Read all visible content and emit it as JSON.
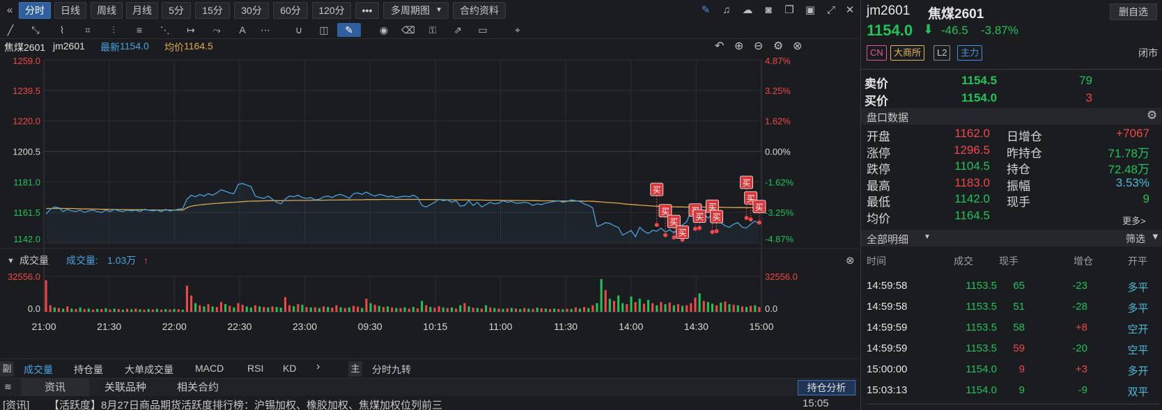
{
  "toolbar": {
    "periods": [
      "分时",
      "日线",
      "周线",
      "月线",
      "5分",
      "15分",
      "30分",
      "60分",
      "120分"
    ],
    "active_period": "分时",
    "more": "•••",
    "multi_period": "多周期图",
    "contract_info": "合约资料"
  },
  "header": {
    "name": "焦煤2601",
    "code": "jm2601",
    "latest_label": "最新",
    "latest_value": "1154.0",
    "avg_label": "均价",
    "avg_value": "1164.5"
  },
  "chart_data": {
    "type": "line",
    "price_axis": {
      "ticks": [
        "1259.0",
        "1239.5",
        "1220.0",
        "1200.5",
        "1181.0",
        "1161.5",
        "1142.0"
      ],
      "min": 1142.0,
      "max": 1259.0,
      "base": 1200.5
    },
    "pct_axis": {
      "ticks": [
        "4.87%",
        "3.25%",
        "1.62%",
        "0.00%",
        "-1.62%",
        "-3.25%",
        "-4.87%"
      ]
    },
    "time_ticks": [
      "21:00",
      "21:30",
      "22:00",
      "22:30",
      "23:00",
      "09:30",
      "10:15",
      "11:00",
      "11:30",
      "14:00",
      "14:30",
      "15:00"
    ],
    "price": [
      1160.5,
      1163.5,
      1165.0,
      1164.5,
      1162.0,
      1163.5,
      1162.5,
      1162.0,
      1163.0,
      1161.5,
      1162.5,
      1163.0,
      1162.0,
      1161.5,
      1163.0,
      1162.0,
      1163.5,
      1162.5,
      1162.0,
      1163.0,
      1162.5,
      1163.0,
      1162.0,
      1163.5,
      1163.0,
      1162.5,
      1163.0,
      1162.0,
      1163.5,
      1162.5,
      1163.0,
      1163.5,
      1164.0,
      1170.0,
      1172.5,
      1171.5,
      1173.0,
      1172.0,
      1173.5,
      1172.5,
      1174.0,
      1176.0,
      1175.0,
      1174.0,
      1173.5,
      1179.5,
      1180.0,
      1179.0,
      1178.0,
      1172.0,
      1171.0,
      1170.5,
      1172.0,
      1170.0,
      1168.0,
      1167.0,
      1170.0,
      1172.0,
      1171.5,
      1172.5,
      1171.0,
      1170.5,
      1171.0,
      1169.5,
      1170.0,
      1171.5,
      1172.0,
      1171.0,
      1172.5,
      1173.0,
      1172.0,
      1170.5,
      1173.5,
      1174.0,
      1173.0,
      1174.5,
      1173.0,
      1172.0,
      1173.0,
      1172.5,
      1171.5,
      1172.0,
      1171.0,
      1171.5,
      1172.0,
      1171.5,
      1172.5,
      1171.0,
      1166.0,
      1165.0,
      1166.5,
      1168.0,
      1170.0,
      1169.0,
      1169.5,
      1168.0,
      1169.0,
      1165.5,
      1166.0,
      1169.0,
      1166.0,
      1168.0,
      1165.0,
      1166.5,
      1168.0,
      1167.0,
      1167.5,
      1169.0,
      1168.0,
      1168.5,
      1167.5,
      1167.5,
      1168.0,
      1167.5,
      1166.0,
      1167.0,
      1166.5,
      1167.5,
      1168.0,
      1168.5,
      1169.0,
      1168.0,
      1168.5,
      1169.5,
      1169.0,
      1168.5,
      1167.0,
      1166.0,
      1164.5,
      1152.5,
      1153.5,
      1155.0,
      1154.5,
      1153.0,
      1152.0,
      1147.0,
      1148.5,
      1150.0,
      1146.0,
      1152.0,
      1149.5,
      1148.0,
      1150.0,
      1149.5,
      1151.5,
      1149.0,
      1150.5,
      1148.5,
      1151.0,
      1153.5,
      1155.5,
      1162.5,
      1165.0,
      1164.0,
      1160.5,
      1158.0,
      1160.0,
      1157.0,
      1155.0,
      1153.0,
      1152.0,
      1154.0,
      1155.0,
      1152.0,
      1151.5,
      1154.0,
      1156.0,
      1154.0
    ],
    "avg": [
      1164.0,
      1164.0,
      1164.0,
      1164.1,
      1164.0,
      1164.0,
      1164.0,
      1163.9,
      1163.8,
      1163.7,
      1163.7,
      1163.6,
      1163.6,
      1163.5,
      1163.5,
      1163.4,
      1163.4,
      1163.3,
      1163.3,
      1163.3,
      1163.2,
      1163.2,
      1163.2,
      1163.2,
      1163.1,
      1163.1,
      1163.1,
      1163.1,
      1163.1,
      1163.0,
      1163.0,
      1163.0,
      1163.0,
      1164.5,
      1165.5,
      1166.0,
      1166.3,
      1166.6,
      1166.9,
      1167.1,
      1167.3,
      1167.5,
      1167.7,
      1167.9,
      1168.0,
      1168.2,
      1168.4,
      1168.6,
      1168.7,
      1168.8,
      1168.8,
      1168.9,
      1169.0,
      1169.0,
      1169.0,
      1169.0,
      1169.1,
      1169.1,
      1169.2,
      1169.2,
      1169.2,
      1169.2,
      1169.3,
      1169.3,
      1169.3,
      1169.3,
      1169.4,
      1169.4,
      1169.4,
      1169.5,
      1169.5,
      1169.5,
      1169.6,
      1169.6,
      1169.6,
      1169.7,
      1169.7,
      1169.7,
      1169.7,
      1169.8,
      1169.8,
      1169.8,
      1169.8,
      1169.8,
      1169.8,
      1169.8,
      1169.8,
      1169.8,
      1169.7,
      1169.7,
      1169.7,
      1169.7,
      1169.7,
      1169.6,
      1169.6,
      1169.6,
      1169.6,
      1169.5,
      1169.5,
      1169.5,
      1169.4,
      1169.4,
      1169.4,
      1169.3,
      1169.3,
      1169.3,
      1169.3,
      1169.2,
      1169.2,
      1169.2,
      1169.2,
      1169.1,
      1169.1,
      1169.1,
      1169.0,
      1169.0,
      1168.9,
      1168.9,
      1168.9,
      1168.9,
      1168.8,
      1168.8,
      1168.8,
      1168.8,
      1168.8,
      1168.8,
      1168.7,
      1168.7,
      1168.6,
      1168.4,
      1168.2,
      1168.0,
      1167.8,
      1167.6,
      1167.4,
      1167.1,
      1166.8,
      1166.6,
      1166.4,
      1166.2,
      1166.0,
      1165.8,
      1165.6,
      1165.5,
      1165.4,
      1165.3,
      1165.2,
      1165.1,
      1165.0,
      1165.0,
      1164.9,
      1164.9,
      1164.9,
      1164.9,
      1164.9,
      1164.8,
      1164.8,
      1164.8,
      1164.8,
      1164.7,
      1164.7,
      1164.6,
      1164.6,
      1164.6,
      1164.5,
      1164.5,
      1164.5,
      1164.5,
      1164.5
    ],
    "buy_markers": [
      {
        "i": 143,
        "price": 1153.5,
        "label": "买"
      },
      {
        "i": 145,
        "price": 1147.0,
        "label": "买"
      },
      {
        "i": 147,
        "price": 1145.5,
        "label": "买"
      },
      {
        "i": 149,
        "price": 1144.0,
        "label": "买"
      },
      {
        "i": 152,
        "price": 1151.0,
        "label": "买"
      },
      {
        "i": 153,
        "price": 1151.5,
        "label": "买"
      },
      {
        "i": 156,
        "price": 1149.0,
        "label": "买"
      },
      {
        "i": 157,
        "price": 1149.5,
        "label": "买"
      },
      {
        "i": 164,
        "price": 1158.0,
        "label": "买"
      },
      {
        "i": 165,
        "price": 1157.0,
        "label": "买"
      },
      {
        "i": 167,
        "price": 1155.0,
        "label": "买"
      }
    ],
    "volume": {
      "ticks": [
        "32556.0",
        "0.0"
      ],
      "max": 32556.0,
      "values": [
        29000,
        6000,
        4000,
        3500,
        2800,
        5000,
        3000,
        2600,
        4000,
        2500,
        3000,
        2000,
        2800,
        2500,
        3300,
        2200,
        3000,
        2500,
        2000,
        2800,
        2400,
        3000,
        2300,
        2000,
        2600,
        2200,
        2800,
        2000,
        2500,
        2200,
        2600,
        2400,
        2000,
        24000,
        15000,
        8000,
        6000,
        5000,
        7000,
        5000,
        4500,
        9000,
        7000,
        5500,
        4000,
        8000,
        6500,
        5000,
        4000,
        6000,
        5000,
        4500,
        4000,
        5000,
        4500,
        3800,
        13500,
        6000,
        5200,
        7000,
        6500,
        4500,
        4000,
        4200,
        3600,
        5000,
        4400,
        3800,
        6000,
        4200,
        3500,
        4000,
        5400,
        4800,
        3500,
        12000,
        8000,
        6500,
        5500,
        4500,
        5000,
        4000,
        3500,
        3500,
        4200,
        3000,
        4500,
        3200,
        10000,
        6000,
        4500,
        3800,
        5200,
        4000,
        3500,
        4000,
        3000,
        6000,
        8000,
        5000,
        3800,
        3500,
        3000,
        6000,
        4000,
        3500,
        3000,
        2800,
        3200,
        3600,
        3000,
        2600,
        3500,
        3000,
        2800,
        3800,
        3200,
        3000,
        2600,
        3000,
        2600,
        2400,
        2800,
        2600,
        4000,
        3000,
        4500,
        3500,
        6000,
        8000,
        30000,
        20000,
        12000,
        10000,
        15000,
        8000,
        7000,
        14000,
        9000,
        12000,
        7500,
        11000,
        8000,
        6000,
        9000,
        7000,
        8500,
        6000,
        7000,
        5500,
        6000,
        8000,
        13000,
        17000,
        10000,
        9000,
        7500,
        6000,
        8500,
        9500,
        7000,
        6500,
        6000,
        5000,
        4500,
        5500,
        6000,
        4500
      ],
      "up": [
        1,
        1,
        0,
        1,
        0,
        1,
        0,
        1,
        0,
        1,
        0,
        1,
        0,
        1,
        0,
        1,
        0,
        1,
        0,
        1,
        0,
        1,
        0,
        1,
        0,
        1,
        0,
        1,
        0,
        1,
        0,
        1,
        0,
        1,
        1,
        0,
        1,
        0,
        1,
        0,
        1,
        1,
        0,
        1,
        0,
        1,
        1,
        0,
        0,
        1,
        0,
        1,
        0,
        1,
        0,
        0,
        1,
        1,
        0,
        1,
        0,
        1,
        0,
        1,
        0,
        1,
        0,
        1,
        1,
        0,
        1,
        0,
        1,
        1,
        0,
        1,
        0,
        1,
        0,
        1,
        0,
        1,
        0,
        1,
        0,
        1,
        0,
        1,
        0,
        1,
        0,
        1,
        1,
        0,
        1,
        0,
        1,
        0,
        1,
        0,
        1,
        0,
        1,
        0,
        1,
        0,
        1,
        0,
        1,
        0,
        1,
        0,
        1,
        0,
        1,
        0,
        1,
        0,
        1,
        0,
        1,
        0,
        1,
        0,
        1,
        0,
        1,
        0,
        1,
        0,
        0,
        1,
        0,
        1,
        0,
        0,
        1,
        0,
        1,
        0,
        1,
        0,
        1,
        0,
        1,
        0,
        1,
        0,
        1,
        0,
        1,
        1,
        1,
        0,
        1,
        0,
        0,
        1,
        0,
        1,
        0,
        1,
        0,
        1,
        0,
        1,
        0,
        1,
        0
      ]
    }
  },
  "volume_header": {
    "title": "成交量",
    "label": "成交量:",
    "value": "1.03万"
  },
  "subtabs": {
    "prefix": "副",
    "items": [
      "成交量",
      "持仓量",
      "大单成交量",
      "MACD",
      "RSI",
      "KD"
    ],
    "main_prefix": "主",
    "main_item": "分时九转"
  },
  "infotabs": {
    "items": [
      "资讯",
      "关联品种",
      "相关合约"
    ],
    "right_button": "持仓分析"
  },
  "news": {
    "tag": "[资讯]",
    "text": "【活跃度】8月27日商品期货活跃度排行榜：沪锡加权、橡胶加权、焦煤加权位列前三",
    "time": "15:05"
  },
  "panel": {
    "code": "jm2601",
    "name": "焦煤2601",
    "remove_button": "删自选",
    "price": "1154.0",
    "change": "-46.5",
    "change_pct": "-3.87%",
    "tags": [
      "CN",
      "大商所",
      "L2",
      "主力"
    ],
    "status": "闭市",
    "ask_label": "卖价",
    "ask_price": "1154.5",
    "ask_vol": "79",
    "bid_label": "买价",
    "bid_price": "1154.0",
    "bid_vol": "3",
    "section_title": "盘口数据",
    "stats_left": [
      {
        "label": "开盘",
        "value": "1162.0"
      },
      {
        "label": "涨停",
        "value": "1296.5"
      },
      {
        "label": "跌停",
        "value": "1104.5"
      },
      {
        "label": "最高",
        "value": "1183.0"
      },
      {
        "label": "最低",
        "value": "1142.0"
      },
      {
        "label": "均价",
        "value": "1164.5"
      }
    ],
    "stats_right": [
      {
        "label": "日增仓",
        "value": "+7067"
      },
      {
        "label": "昨持仓",
        "value": "71.78万"
      },
      {
        "label": "持仓",
        "value": "72.48万"
      },
      {
        "label": "振幅",
        "value": "3.53%"
      },
      {
        "label": "现手",
        "value": "9"
      }
    ],
    "more": "更多>",
    "detail_title": "全部明细",
    "filter": "筛选",
    "columns": [
      "时间",
      "成交",
      "现手",
      "增仓",
      "开平"
    ],
    "trades": [
      {
        "time": "14:59:58",
        "price": "1153.5",
        "vol": "65",
        "oi": "-23",
        "type": "多平"
      },
      {
        "time": "14:59:58",
        "price": "1153.5",
        "vol": "51",
        "oi": "-28",
        "type": "多平"
      },
      {
        "time": "14:59:59",
        "price": "1153.5",
        "vol": "58",
        "oi": "+8",
        "type": "空开"
      },
      {
        "time": "14:59:59",
        "price": "1153.5",
        "vol": "59",
        "oi": "-20",
        "type": "空平"
      },
      {
        "time": "15:00:00",
        "price": "1154.0",
        "vol": "9",
        "oi": "+3",
        "type": "多开"
      },
      {
        "time": "15:03:13",
        "price": "1154.0",
        "vol": "9",
        "oi": "-9",
        "type": "双平"
      }
    ]
  },
  "colors": {
    "up": "#f04848",
    "down": "#21c25a",
    "price_line": "#4aa3df",
    "avg_line": "#e0a94f",
    "accent": "#2f6fc9"
  }
}
